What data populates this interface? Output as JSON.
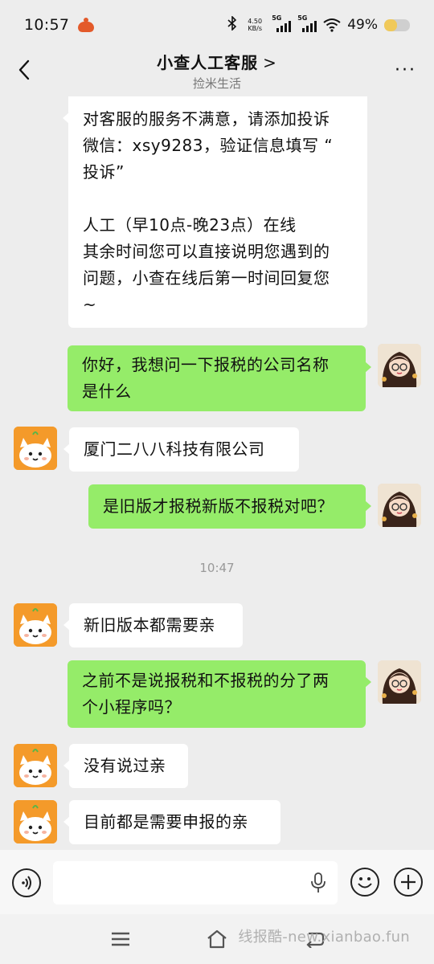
{
  "status_bar": {
    "time": "10:57",
    "net_speed_value": "4.50",
    "net_speed_unit": "KB/s",
    "sim1": "5G",
    "sim2": "5G",
    "battery_percent_text": "49%",
    "battery_level": 0.49
  },
  "header": {
    "title": "小查人工客服",
    "title_arrow": ">",
    "subtitle": "捡米生活",
    "more_label": "···"
  },
  "messages": [
    {
      "sender": "bot",
      "lines": [
        "对客服的服务不满意，请添加投诉",
        "微信：xsy9283，验证信息填写 “",
        "投诉”",
        "",
        "人工（早10点-晚23点）在线",
        "其余时间您可以直接说明您遇到的",
        "问题，小查在线后第一时间回复您",
        "~"
      ]
    },
    {
      "sender": "user",
      "lines": [
        "你好，我想问一下报税的公司名称",
        "是什么"
      ]
    },
    {
      "sender": "bot",
      "lines": [
        "厦门二八八科技有限公司"
      ]
    },
    {
      "sender": "user",
      "lines": [
        "是旧版才报税新版不报税对吧？"
      ]
    },
    {
      "sender": "bot",
      "lines": [
        "新旧版本都需要亲"
      ]
    },
    {
      "sender": "user",
      "lines": [
        "之前不是说报税和不报税的分了两",
        "个小程序吗？"
      ]
    },
    {
      "sender": "bot",
      "lines": [
        "没有说过亲"
      ]
    },
    {
      "sender": "bot",
      "lines": [
        "目前都是需要申报的亲"
      ]
    }
  ],
  "timestamp": "10:47",
  "input": {
    "placeholder": ""
  },
  "icons": {
    "back": "back-chevron-icon",
    "more": "more-dots-icon",
    "voice": "voice-icon",
    "mic": "microphone-icon",
    "emoji": "emoji-icon",
    "plus": "plus-icon",
    "menu": "menu-icon",
    "home": "home-icon",
    "nav_back": "nav-back-icon"
  },
  "colors": {
    "chat_bg": "#ededed",
    "user_bubble": "#95ec69",
    "bot_bubble": "#ffffff",
    "bot_avatar": "#f49a2a"
  },
  "watermark": "线报酷-new.xianbao.fun"
}
